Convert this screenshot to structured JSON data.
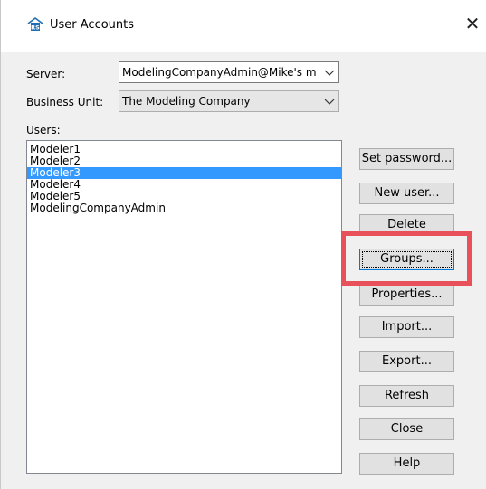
{
  "window": {
    "title": "User Accounts",
    "icon": "rs-app-icon",
    "close_glyph": "✕"
  },
  "form": {
    "server_label": "Server:",
    "server_value": "ModelingCompanyAdmin@Mike's m",
    "business_unit_label": "Business Unit:",
    "business_unit_value": "The Modeling Company",
    "users_label": "Users:"
  },
  "users": [
    {
      "name": "Modeler1",
      "selected": false
    },
    {
      "name": "Modeler2",
      "selected": false
    },
    {
      "name": "Modeler3",
      "selected": true
    },
    {
      "name": "Modeler4",
      "selected": false
    },
    {
      "name": "Modeler5",
      "selected": false
    },
    {
      "name": "ModelingCompanyAdmin",
      "selected": false
    }
  ],
  "buttons": {
    "set_password": "Set password...",
    "new_user": "New user...",
    "delete": "Delete",
    "groups": "Groups...",
    "properties": "Properties...",
    "import": "Import...",
    "export": "Export...",
    "refresh": "Refresh",
    "close": "Close",
    "help": "Help"
  },
  "highlight_color": "#e8505a",
  "selection_color": "#3399ff"
}
